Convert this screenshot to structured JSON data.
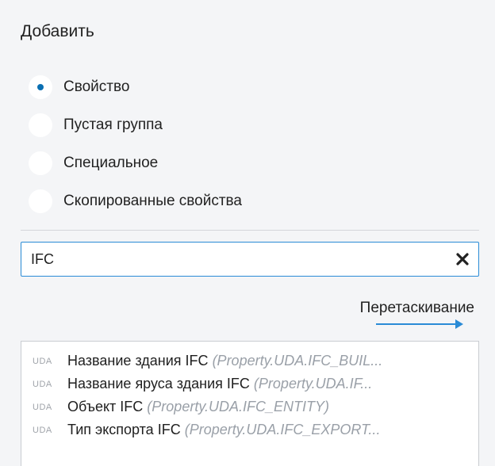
{
  "panel": {
    "title": "Добавить"
  },
  "radio_options": [
    {
      "label": "Свойство",
      "selected": true
    },
    {
      "label": "Пустая группа",
      "selected": false
    },
    {
      "label": "Специальное",
      "selected": false
    },
    {
      "label": "Скопированные свойства",
      "selected": false
    }
  ],
  "search": {
    "value": "IFC",
    "clear_icon": "close-icon"
  },
  "drag_hint": {
    "label": "Перетаскивание",
    "arrow_icon": "arrow-right-icon",
    "arrow_color": "#2a8bd6"
  },
  "results": [
    {
      "badge": "UDA",
      "name": "Название здания IFC",
      "property": "(Property.UDA.IFC_BUIL..."
    },
    {
      "badge": "UDA",
      "name": "Название яруса здания IFC",
      "property": "(Property.UDA.IF..."
    },
    {
      "badge": "UDA",
      "name": "Объект IFC",
      "property": "(Property.UDA.IFC_ENTITY)"
    },
    {
      "badge": "UDA",
      "name": "Тип экспорта IFC",
      "property": "(Property.UDA.IFC_EXPORT..."
    }
  ],
  "colors": {
    "accent": "#0a6fb2",
    "focus_border": "#2a8bd6",
    "background": "#f4f5f7"
  }
}
